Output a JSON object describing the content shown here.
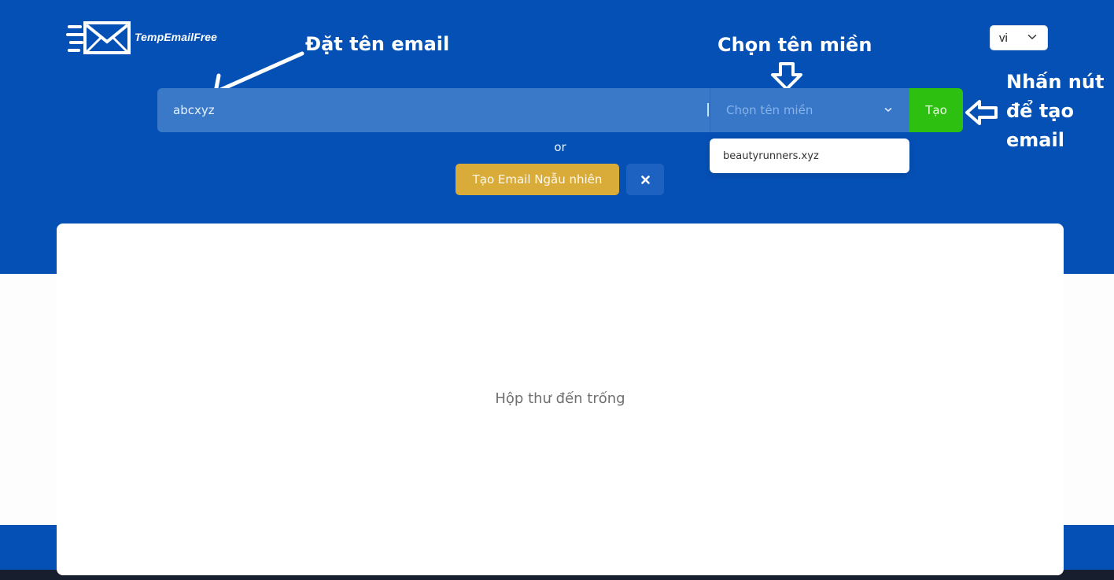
{
  "brand": {
    "name": "TempEmailFree",
    "logo_icon": "envelope-speed-icon"
  },
  "language_select": {
    "value": "vi",
    "icon": "chevron-down-icon"
  },
  "annotations": {
    "name_email": "Đặt tên email",
    "choose_domain": "Chọn tên miền",
    "click_to_create": "Nhấn nút\nđể tạo\nemail"
  },
  "form": {
    "email_name_value": "abcxyz",
    "domain_placeholder": "Chọn tên miền",
    "create_label": "Tạo",
    "domain_options": [
      "beautyrunners.xyz"
    ],
    "or_label": "or",
    "random_label": "Tạo Email Ngẫu nhiên",
    "clear_icon": "close-icon"
  },
  "inbox": {
    "empty_message": "Hộp thư đến trống"
  },
  "colors": {
    "primary_blue": "#0450b4",
    "input_blue": "#3a78c8",
    "create_green": "#2ec011",
    "random_gold": "#d9ac3a",
    "footer_dark": "#171f2e"
  }
}
